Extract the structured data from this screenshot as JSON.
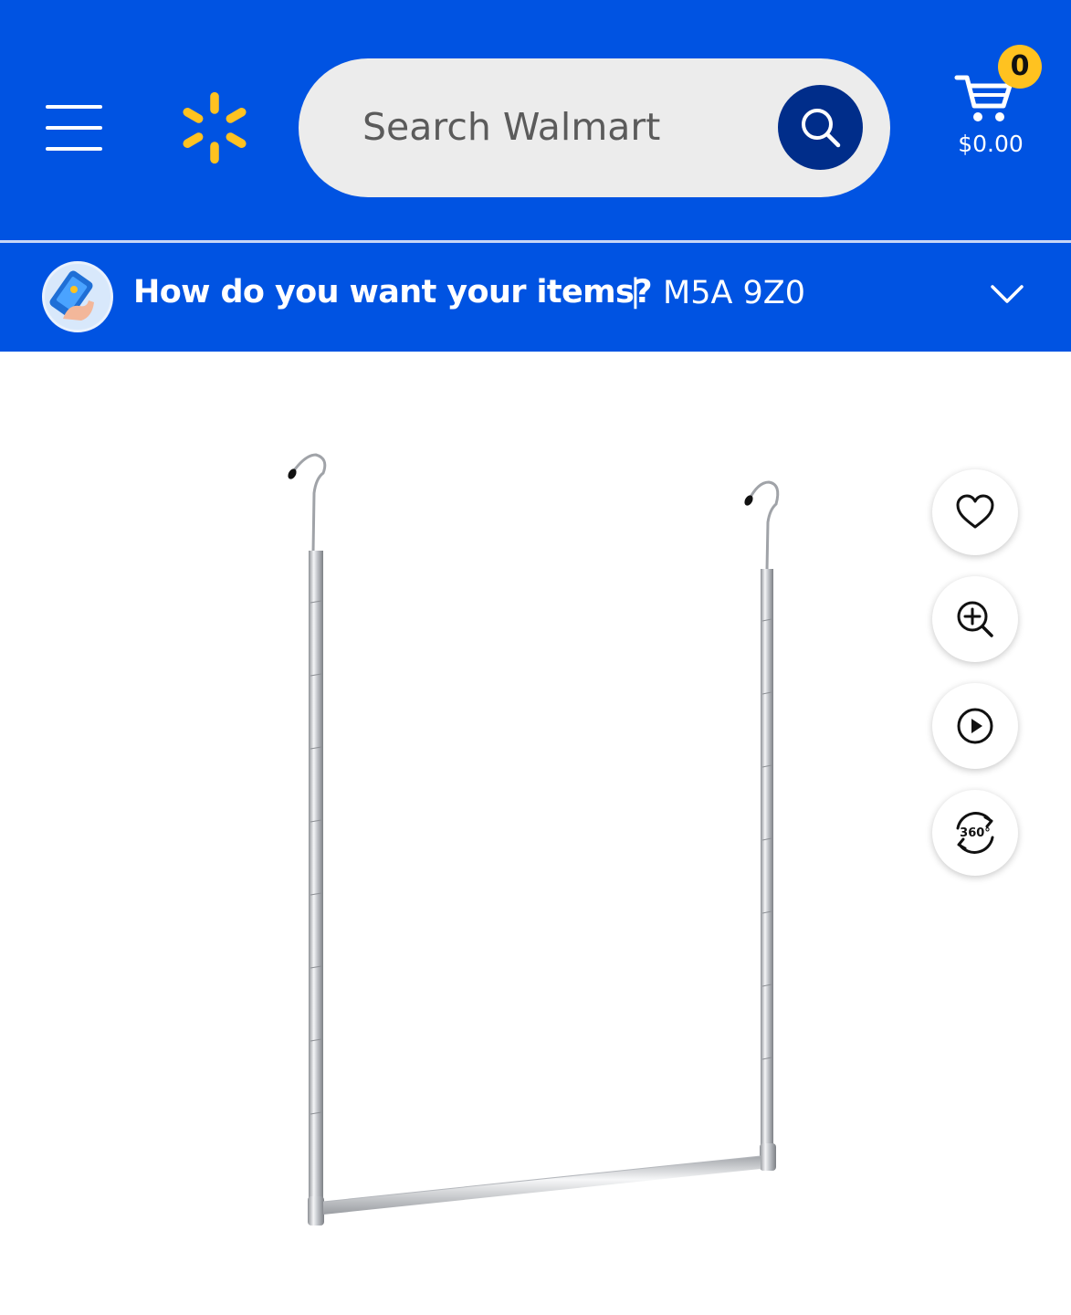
{
  "header": {
    "search": {
      "placeholder": "Search Walmart"
    },
    "cart": {
      "count": "0",
      "total": "$0.00"
    },
    "colors": {
      "brand_blue": "#0053e2",
      "search_button": "#002d8a",
      "spark_yellow": "#ffc220"
    }
  },
  "fulfillment": {
    "question": "How do you want your items?",
    "separator": "|",
    "postal_code": "M5A 9Z0"
  },
  "product_actions": [
    {
      "icon": "heart-icon"
    },
    {
      "icon": "zoom-in-icon"
    },
    {
      "icon": "play-video-icon"
    },
    {
      "icon": "view-360-icon",
      "label": "360°"
    }
  ]
}
